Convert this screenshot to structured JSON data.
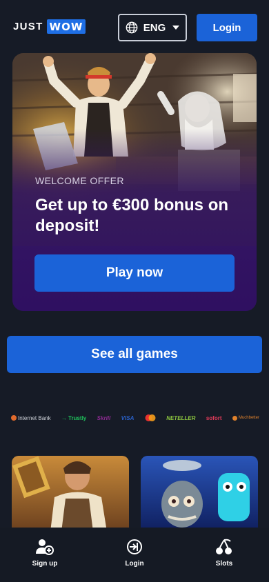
{
  "header": {
    "logo_left": "JUST",
    "logo_right": "WOW",
    "language": "ENG",
    "login_label": "Login"
  },
  "hero": {
    "eyebrow": "WELCOME OFFER",
    "title": "Get up to €300 bonus on deposit!",
    "cta_label": "Play now"
  },
  "see_all_label": "See all games",
  "payments": [
    {
      "name": "Internet Bank",
      "color": "#e06a2c"
    },
    {
      "name": "Trustly",
      "color": "#1fc55c"
    },
    {
      "name": "Skrill",
      "color": "#8a2a8f"
    },
    {
      "name": "VISA",
      "color": "#2a61c9"
    },
    {
      "name": "mastercard",
      "color": "#e8312f"
    },
    {
      "name": "NETELLER",
      "color": "#8cc63f"
    },
    {
      "name": "sofort",
      "color": "#e23b5a"
    },
    {
      "name": "Muchbetter",
      "color": "#e0822c"
    }
  ],
  "bottom_nav": {
    "signup_label": "Sign up",
    "login_label": "Login",
    "slots_label": "Slots"
  },
  "colors": {
    "background": "#161b26",
    "accent": "#1b63d8",
    "hero_purple": "#2f1061"
  }
}
